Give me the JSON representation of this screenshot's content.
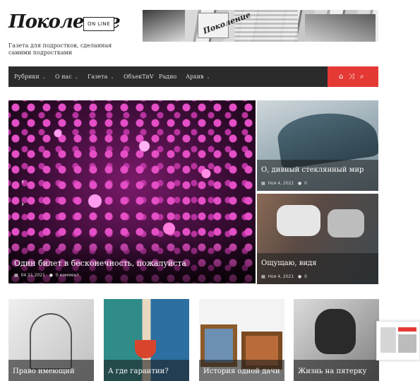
{
  "header": {
    "logo_script": "Поколение",
    "logo_badge": "ON LINE",
    "tagline": "Газета для подростков, сделанная самими подростками",
    "banner_text": "Поколение"
  },
  "nav": {
    "items": [
      {
        "label": "Рубрики",
        "has_dropdown": true
      },
      {
        "label": "О нас",
        "has_dropdown": true
      },
      {
        "label": "Газета",
        "has_dropdown": true
      },
      {
        "label": "ОбъекТиV",
        "has_dropdown": false
      },
      {
        "label": "Радио",
        "has_dropdown": false
      },
      {
        "label": "Архив",
        "has_dropdown": true
      }
    ],
    "chevron": "⌄",
    "icons": [
      {
        "name": "home-icon",
        "glyph": "⌂"
      },
      {
        "name": "shuffle-icon",
        "glyph": "⤨"
      },
      {
        "name": "search-icon",
        "glyph": "⌕"
      }
    ],
    "accent": "#e53935"
  },
  "hero": {
    "title": "Один билет в бесконечность, пожалуйста",
    "date": "04.11.2021",
    "comments": "0 коммент",
    "prev_glyph": "‹",
    "next_glyph": "›"
  },
  "side_articles": [
    {
      "title": "О, дивный стеклянный мир",
      "date": "Ноя 4, 2021",
      "comments": "0"
    },
    {
      "title": "Ощущаю, видя",
      "date": "Ноя 4, 2021",
      "comments": "0"
    }
  ],
  "bottom_articles": [
    {
      "title": "Право имеющий"
    },
    {
      "title": "А где гарантии?"
    },
    {
      "title": "История одной дачи"
    },
    {
      "title": "Жизнь на пятерку"
    }
  ],
  "icons": {
    "calendar": "▦",
    "comment": "●"
  }
}
